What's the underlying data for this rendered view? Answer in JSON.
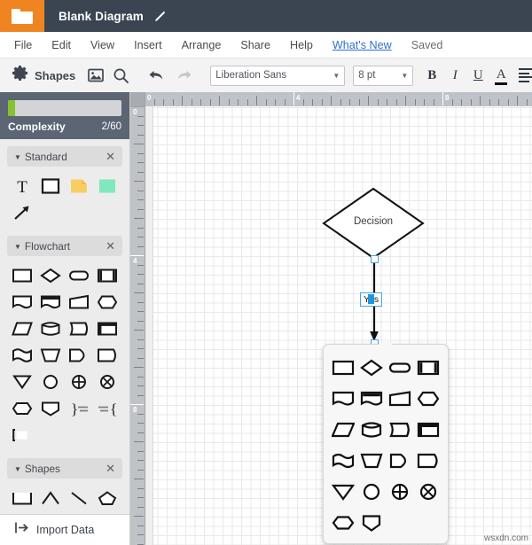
{
  "titlebar": {
    "folder_icon": "folder-icon",
    "title": "Blank Diagram",
    "edit_icon": "pencil-icon"
  },
  "menubar": {
    "items": [
      {
        "label": "File",
        "type": "menu"
      },
      {
        "label": "Edit",
        "type": "menu"
      },
      {
        "label": "View",
        "type": "menu"
      },
      {
        "label": "Insert",
        "type": "menu"
      },
      {
        "label": "Arrange",
        "type": "menu"
      },
      {
        "label": "Share",
        "type": "menu"
      },
      {
        "label": "Help",
        "type": "menu"
      },
      {
        "label": "What's New",
        "type": "link"
      },
      {
        "label": "Saved",
        "type": "status"
      }
    ]
  },
  "toolbar": {
    "shapes_label": "Shapes",
    "shapes_icon": "gear-icon",
    "image_icon": "image-icon",
    "search_icon": "search-icon",
    "undo_icon": "undo-arrow-icon",
    "redo_icon": "redo-arrow-icon",
    "font_family": "Liberation Sans",
    "font_size": "8 pt",
    "bold_label": "B",
    "italic_label": "I",
    "underline_label": "U",
    "font_color_label": "A",
    "font_color_swatch": "#111111",
    "align_icon": "align-left-icon"
  },
  "sidebar": {
    "complexity": {
      "label": "Complexity",
      "value": "2/60",
      "percent": 3,
      "bar_color": "#86c232",
      "panel_color": "#5b6573"
    },
    "sections": [
      {
        "name": "standard",
        "title": "Standard",
        "collapse_icon": "chevron-down-icon",
        "close_icon": "close-icon",
        "shapes": [
          {
            "name": "text-shape"
          },
          {
            "name": "rectangle-shape"
          },
          {
            "name": "note-shape"
          },
          {
            "name": "green-square-shape"
          },
          {
            "name": "arrow-shape"
          }
        ]
      },
      {
        "name": "flowchart",
        "title": "Flowchart",
        "collapse_icon": "chevron-down-icon",
        "close_icon": "close-icon",
        "shapes": [
          {
            "name": "process-shape"
          },
          {
            "name": "decision-shape"
          },
          {
            "name": "terminator-shape"
          },
          {
            "name": "predefined-process-shape"
          },
          {
            "name": "document-shape"
          },
          {
            "name": "multi-document-shape"
          },
          {
            "name": "manual-input-shape"
          },
          {
            "name": "preparation-shape"
          },
          {
            "name": "data-shape"
          },
          {
            "name": "direct-access-storage-shape"
          },
          {
            "name": "stored-data-shape"
          },
          {
            "name": "internal-storage-shape"
          },
          {
            "name": "paper-tape-shape"
          },
          {
            "name": "manual-operation-shape"
          },
          {
            "name": "display-shape"
          },
          {
            "name": "delay-shape"
          },
          {
            "name": "extract-shape"
          },
          {
            "name": "connector-shape"
          },
          {
            "name": "summing-junction-shape"
          },
          {
            "name": "or-shape"
          },
          {
            "name": "loop-limit-shape"
          },
          {
            "name": "merge-shape"
          },
          {
            "name": "collate-shape"
          },
          {
            "name": "sort-shape"
          },
          {
            "name": "card-shape"
          }
        ]
      },
      {
        "name": "shapes",
        "title": "Shapes",
        "collapse_icon": "chevron-down-icon",
        "close_icon": "close-icon",
        "shapes": [
          {
            "name": "open-rectangle-shape"
          },
          {
            "name": "chevron-up-shape"
          },
          {
            "name": "diagonal-line-shape"
          },
          {
            "name": "pentagon-shape"
          }
        ]
      }
    ],
    "footer": {
      "label": "Import Data",
      "icon": "import-icon"
    }
  },
  "canvas": {
    "ruler_h_labels": [
      "0",
      "4",
      "8"
    ],
    "ruler_v_labels": [
      "0",
      "4",
      "8"
    ],
    "nodes": [
      {
        "name": "decision-node",
        "shape": "diamond",
        "label": "Decision"
      }
    ],
    "edges": [
      {
        "name": "yes-connector",
        "label": "Yes",
        "selected": true,
        "editing": true
      }
    ],
    "shape_picker": {
      "name": "shape-picker-popup",
      "visible": true,
      "shapes": [
        {
          "name": "process-shape"
        },
        {
          "name": "decision-shape"
        },
        {
          "name": "terminator-shape"
        },
        {
          "name": "predefined-process-shape"
        },
        {
          "name": "document-shape"
        },
        {
          "name": "multi-document-shape"
        },
        {
          "name": "manual-input-shape"
        },
        {
          "name": "preparation-shape"
        },
        {
          "name": "data-shape"
        },
        {
          "name": "direct-access-storage-shape"
        },
        {
          "name": "stored-data-shape"
        },
        {
          "name": "internal-storage-shape"
        },
        {
          "name": "paper-tape-shape"
        },
        {
          "name": "manual-operation-shape"
        },
        {
          "name": "display-shape"
        },
        {
          "name": "delay-shape"
        },
        {
          "name": "extract-shape"
        },
        {
          "name": "connector-shape"
        },
        {
          "name": "summing-junction-shape"
        },
        {
          "name": "or-shape"
        },
        {
          "name": "loop-limit-shape"
        },
        {
          "name": "merge-shape"
        }
      ]
    }
  },
  "watermark": "wsxdn.com"
}
